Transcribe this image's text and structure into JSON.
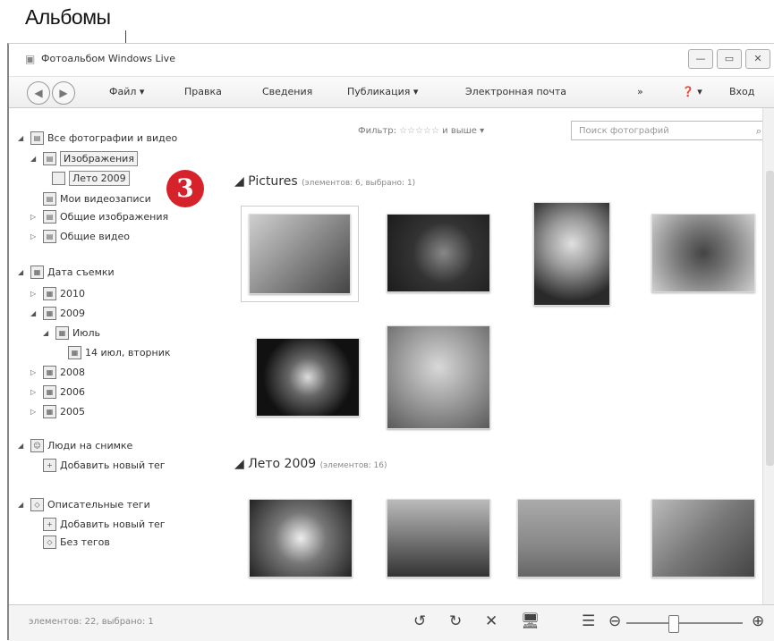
{
  "callout": {
    "label": "Альбомы",
    "step_number": "3"
  },
  "window": {
    "title": "Фотоальбом Windows Live",
    "controls": [
      "—",
      "▭",
      "✕"
    ]
  },
  "toolbar": {
    "menus": [
      "Файл ▾",
      "Правка",
      "Сведения",
      "Публикация ▾",
      "Электронная почта",
      "»"
    ],
    "help": "❓ ▾",
    "signin": "Вход"
  },
  "sidebar": {
    "all": "Все фотографии и видео",
    "images": "Изображения",
    "leto": "Лето 2009",
    "myvideos": "Мои видеозаписи",
    "shared_images": "Общие изображения",
    "shared_video": "Общие видео",
    "date_taken": "Дата съемки",
    "y2010": "2010",
    "y2009": "2009",
    "july": "Июль",
    "day": "14 июл, вторник",
    "y2008": "2008",
    "y2006": "2006",
    "y2005": "2005",
    "people": "Люди на снимке",
    "add_person": "Добавить новый тег",
    "desc_tags": "Описательные теги",
    "add_tag": "Добавить новый тег",
    "no_tags": "Без тегов"
  },
  "filter": {
    "label": "Фильтр:",
    "stars": "☆☆☆☆☆",
    "suffix": "и выше ▾"
  },
  "search": {
    "placeholder": "Поиск фотографий"
  },
  "groups": [
    {
      "title": "Pictures",
      "count": "(элементов: 6, выбрано: 1)"
    },
    {
      "title": "Лето 2009",
      "count": "(элементов: 16)"
    }
  ],
  "statusbar": {
    "text": "элементов: 22, выбрано: 1",
    "icons": [
      "↺",
      "↻",
      "✕",
      "🖥",
      "☰",
      "⊖",
      "⊕"
    ]
  },
  "colors": {
    "badge": "#d6222b",
    "toolbar": "#eeeeee"
  }
}
